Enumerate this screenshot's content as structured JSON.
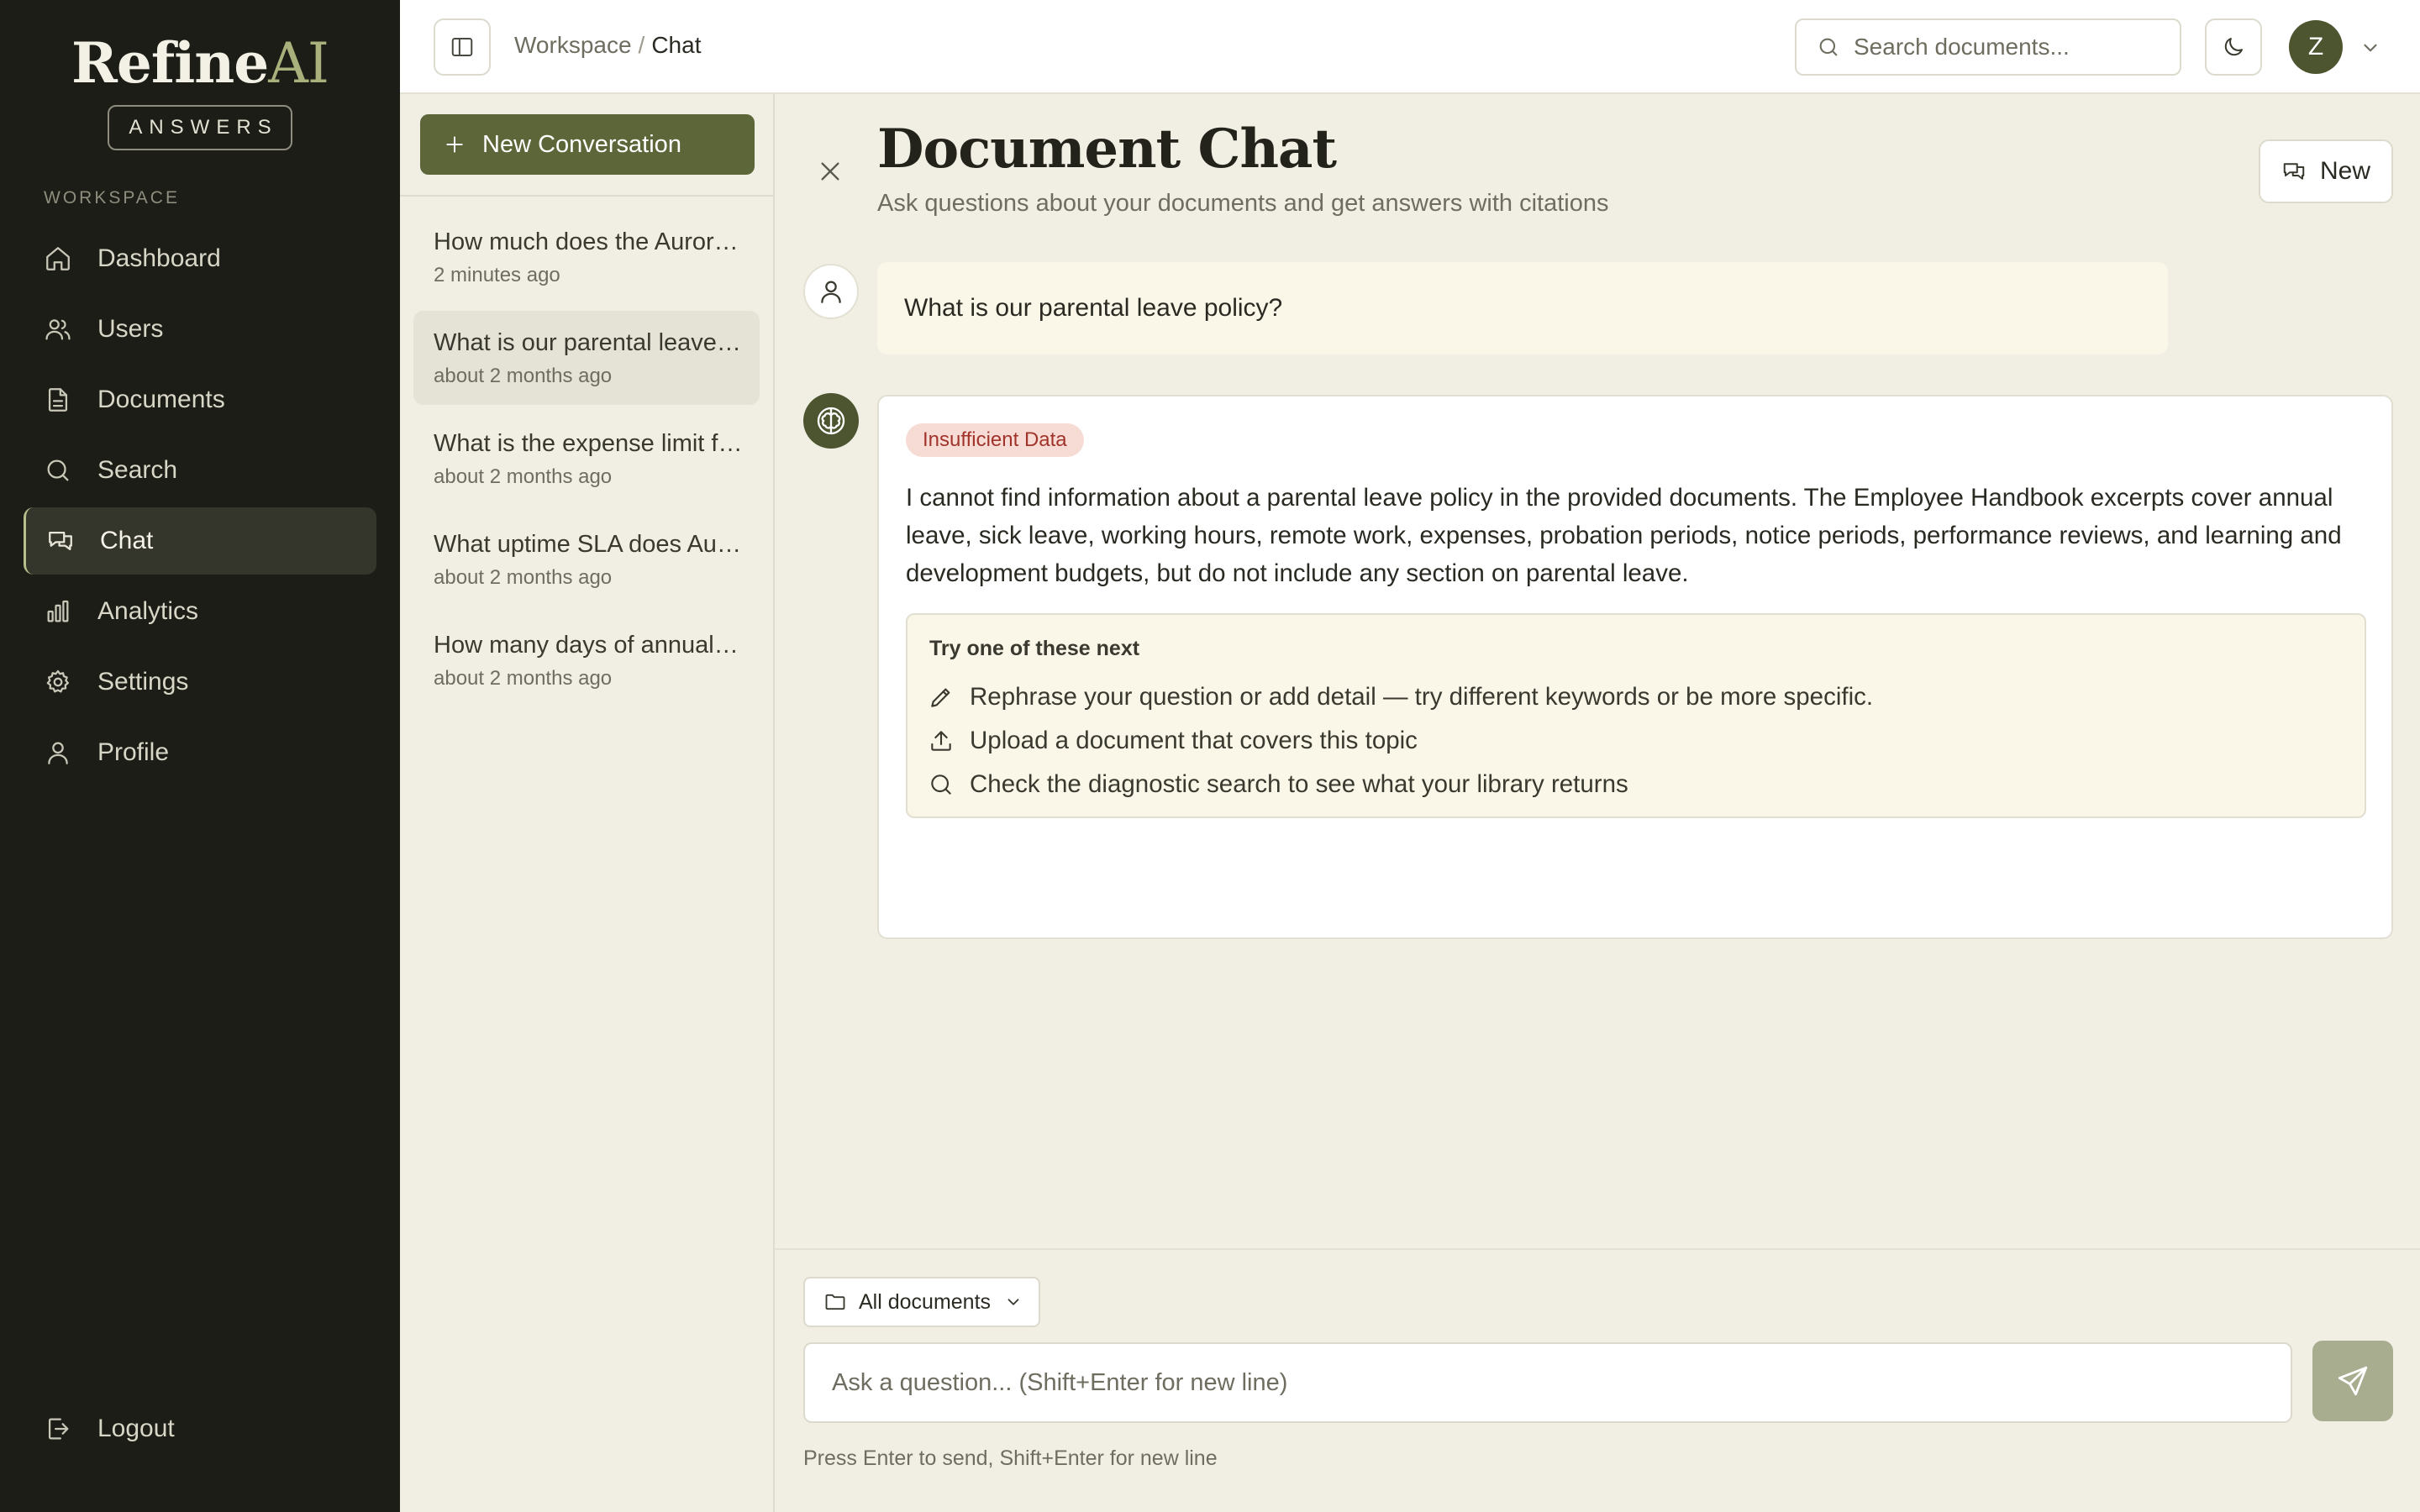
{
  "brand": {
    "name": "Refine",
    "name_accent": "AI",
    "tagline": "ANSWERS"
  },
  "sidebar": {
    "section_label": "WORKSPACE",
    "items": [
      {
        "label": "Dashboard",
        "icon": "home-icon"
      },
      {
        "label": "Users",
        "icon": "users-icon"
      },
      {
        "label": "Documents",
        "icon": "document-icon"
      },
      {
        "label": "Search",
        "icon": "search-icon"
      },
      {
        "label": "Chat",
        "icon": "chat-icon",
        "active": true
      },
      {
        "label": "Analytics",
        "icon": "bar-chart-icon"
      },
      {
        "label": "Settings",
        "icon": "gear-icon"
      },
      {
        "label": "Profile",
        "icon": "user-icon"
      }
    ],
    "logout_label": "Logout"
  },
  "topbar": {
    "breadcrumb": {
      "parent": "Workspace",
      "separator": "/",
      "current": "Chat"
    },
    "search_placeholder": "Search documents...",
    "avatar_initial": "Z"
  },
  "conversations": {
    "new_label": "New Conversation",
    "items": [
      {
        "title": "How much does the Aurora...",
        "time": "2 minutes ago"
      },
      {
        "title": "What is our parental leave policy?",
        "time": "about 2 months ago",
        "active": true
      },
      {
        "title": "What is the expense limit for...",
        "time": "about 2 months ago"
      },
      {
        "title": "What uptime SLA does Aurora...",
        "time": "about 2 months ago"
      },
      {
        "title": "How many days of annual leave...",
        "time": "about 2 months ago"
      }
    ]
  },
  "main": {
    "title": "Document Chat",
    "subtitle": "Ask questions about your documents and get answers with citations",
    "new_button": "New",
    "user_message": "What is our parental leave policy?",
    "ai_badge": "Insufficient Data",
    "ai_answer": "I cannot find information about a parental leave policy in the provided documents. The Employee Handbook excerpts cover annual leave, sick leave, working hours, remote work, expenses, probation periods, notice periods, performance reviews, and learning and development budgets, but do not include any section on parental leave.",
    "suggestions": {
      "title": "Try one of these next",
      "items": [
        {
          "label": "Rephrase your question or add detail — try different keywords or be more specific.",
          "icon": "pencil-icon"
        },
        {
          "label": "Upload a document that covers this topic",
          "icon": "upload-icon"
        },
        {
          "label": "Check the diagnostic search to see what your library returns",
          "icon": "search-icon"
        }
      ]
    },
    "scope_label": "All documents",
    "composer_placeholder": "Ask a question... (Shift+Enter for new line)",
    "hint": "Press Enter to send, Shift+Enter for new line"
  },
  "colors": {
    "sidebar_bg": "#1c1d16",
    "accent": "#5d6638",
    "badge_bg": "#f7dcd6",
    "badge_text": "#a1342a"
  }
}
